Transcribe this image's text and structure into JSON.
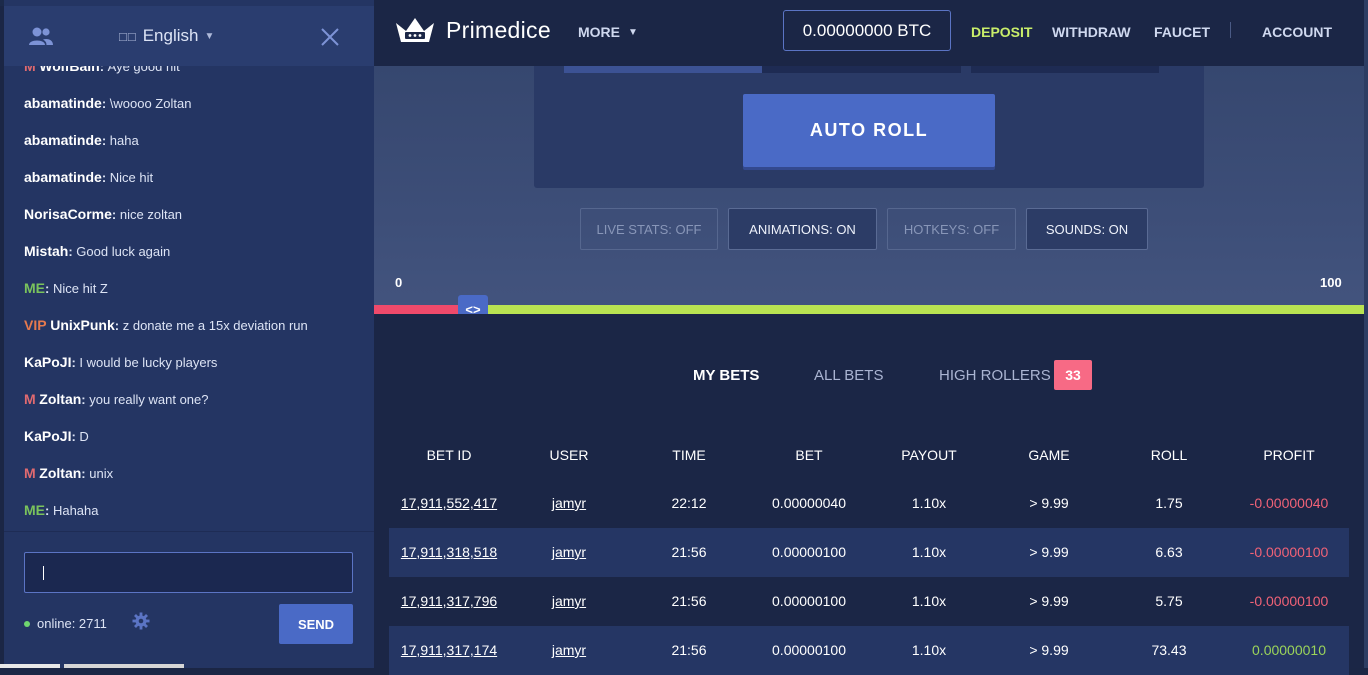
{
  "sidebar": {
    "language": "English",
    "language_icon_text": "□□",
    "messages": [
      {
        "tag": "M",
        "user": "WolfBain",
        "text": "Aye good hit",
        "me": false
      },
      {
        "tag": "",
        "user": "abamatinde",
        "text": "\\woooo Zoltan",
        "me": false
      },
      {
        "tag": "",
        "user": "abamatinde",
        "text": "haha",
        "me": false
      },
      {
        "tag": "",
        "user": "abamatinde",
        "text": "Nice hit",
        "me": false
      },
      {
        "tag": "",
        "user": "NorisaCorme",
        "text": "nice zoltan",
        "me": false
      },
      {
        "tag": "",
        "user": "Mistah",
        "text": "Good luck again",
        "me": false
      },
      {
        "tag": "",
        "user": "ME",
        "text": "Nice hit Z",
        "me": true
      },
      {
        "tag": "VIP",
        "user": "UnixPunk",
        "text": "z donate me a 15x deviation run",
        "me": false
      },
      {
        "tag": "",
        "user": "KaPoJI",
        "text": "I would be lucky players",
        "me": false
      },
      {
        "tag": "M",
        "user": "Zoltan",
        "text": "you really want one?",
        "me": false
      },
      {
        "tag": "",
        "user": "KaPoJI",
        "text": "D",
        "me": false
      },
      {
        "tag": "M",
        "user": "Zoltan",
        "text": "unix",
        "me": false
      },
      {
        "tag": "",
        "user": "ME",
        "text": "Hahaha",
        "me": true
      }
    ],
    "input_value": "",
    "online_label": "online: 2711",
    "send_label": "SEND"
  },
  "nav": {
    "brand": "Primedice",
    "more": "MORE",
    "balance": "0.00000000 BTC",
    "deposit": "DEPOSIT",
    "withdraw": "WITHDRAW",
    "faucet": "FAUCET",
    "account": "ACCOUNT"
  },
  "game": {
    "auto_roll": "AUTO ROLL",
    "toggles": {
      "live_stats": "LIVE STATS: OFF",
      "animations": "ANIMATIONS: ON",
      "hotkeys": "HOTKEYS: OFF",
      "sounds": "SOUNDS: ON"
    },
    "slider_min": "0",
    "slider_max": "100",
    "slider_value": 9.99,
    "handle_glyph": "<>"
  },
  "bets": {
    "tabs": {
      "my": "MY BETS",
      "all": "ALL BETS",
      "high": "HIGH ROLLERS"
    },
    "high_count": "33",
    "headers": [
      "BET ID",
      "USER",
      "TIME",
      "BET",
      "PAYOUT",
      "GAME",
      "ROLL",
      "PROFIT"
    ],
    "rows": [
      [
        "17,911,552,417",
        "jamyr",
        "22:12",
        "0.00000040",
        "1.10x",
        "> 9.99",
        "1.75",
        "-0.00000040"
      ],
      [
        "17,911,318,518",
        "jamyr",
        "21:56",
        "0.00000100",
        "1.10x",
        "> 9.99",
        "6.63",
        "-0.00000100"
      ],
      [
        "17,911,317,796",
        "jamyr",
        "21:56",
        "0.00000100",
        "1.10x",
        "> 9.99",
        "5.75",
        "-0.00000100"
      ],
      [
        "17,911,317,174",
        "jamyr",
        "21:56",
        "0.00000100",
        "1.10x",
        "> 9.99",
        "73.43",
        "0.00000010"
      ]
    ]
  },
  "colors": {
    "accent": "#4a6ac6",
    "deposit": "#c9ee6a",
    "loss": "#f06277",
    "win": "#9bd45a",
    "slider_lose": "#ef4a6b",
    "slider_win": "#b9e352",
    "badge": "#f76a85"
  }
}
